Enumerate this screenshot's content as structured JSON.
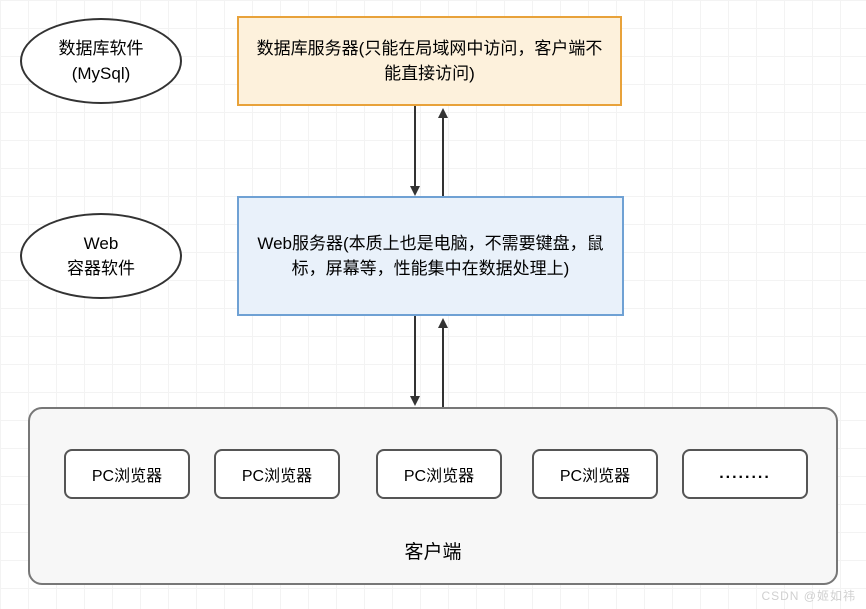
{
  "nodes": {
    "db_ellipse": "数据库软件\n(MySql)",
    "db_box": "数据库服务器(只能在局域网中访问，客户端不能直接访问)",
    "web_ellipse": "Web\n容器软件",
    "web_box": "Web服务器(本质上也是电脑，不需要键盘，鼠标，屏幕等，性能集中在数据处理上)",
    "client_title": "客户端",
    "browsers": [
      "PC浏览器",
      "PC浏览器",
      "PC浏览器",
      "PC浏览器",
      "........"
    ]
  },
  "watermark": "CSDN @姬如祎"
}
